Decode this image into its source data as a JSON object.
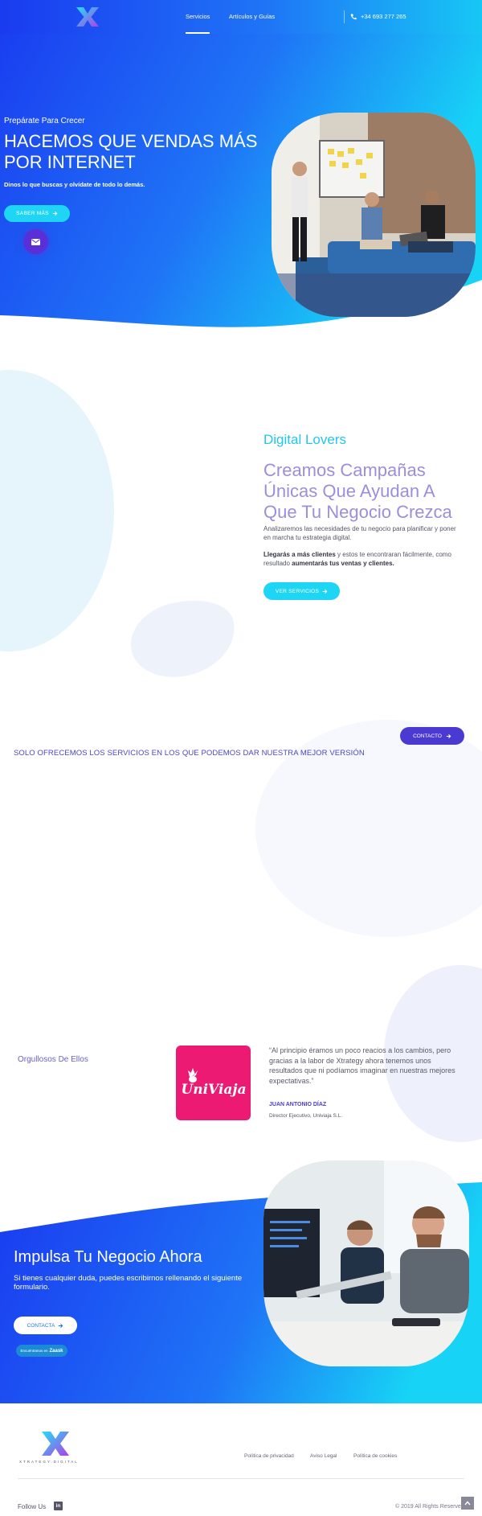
{
  "header": {
    "nav": [
      {
        "label": "Servicios",
        "active": true
      },
      {
        "label": "Artículos y Guías",
        "active": false
      }
    ],
    "phone": "+34 693 277 265",
    "icons": [
      "logo-x",
      "phone-icon"
    ]
  },
  "hero": {
    "kicker": "Prepárate Para Crecer",
    "title": "HACEMOS QUE VENDAS MÁS POR INTERNET",
    "subtitle": "Dinos lo que buscas y olvídate de todo lo demás.",
    "cta": "SABER MÁS",
    "icons": [
      "arrow-right-icon",
      "mail-icon"
    ]
  },
  "lovers": {
    "kicker": "Digital Lovers",
    "title": "Creamos Campañas Únicas Que Ayudan A Que Tu Negocio Crezca",
    "p1": "Analizaremos las necesidades de tu negocio para planificar y poner en marcha tu estrategia digital.",
    "p2_a": "Llegarás a más clientes",
    "p2_b": " y estos te encontraran fácilmente, como resultado ",
    "p2_c": "aumentarás tus ventas y clientes.",
    "cta": "VER SERVICIOS"
  },
  "services": {
    "contact_button": "CONTACTO",
    "heading": "SOLO OFRECEMOS LOS SERVICIOS EN LOS QUE PODEMOS DAR NUESTRA MEJOR VERSIÓN"
  },
  "testimonial": {
    "kicker": "Orgullosos De Ellos",
    "logo_text": "UniViaja",
    "quote": "“Al principio éramos un poco reacios a los cambios, pero gracias a la labor de Xtrategy ahora tenemos unos resultados que ni podíamos imaginar en nuestras mejores expectativas.”",
    "name": "JUAN ANTONIO DÍAZ",
    "role": "Director Ejecutivo, Univiaja S.L."
  },
  "cta": {
    "title": "Impulsa Tu Negocio Ahora",
    "subtitle": "Si tienes cualquier duda, puedes escribirnos rellenando el siguiente formulario.",
    "button": "CONTACTA",
    "zaask_prefix": "Encuéntranos en",
    "zaask_brand": "Zaask"
  },
  "footer": {
    "brand": "XTRATEGY.DIGITAL",
    "links": [
      "Política de privacidad",
      "Aviso Legal",
      "Política de cookies"
    ],
    "follow": "Follow Us",
    "linkedin": "in",
    "copyright": "© 2019 All Rights Reserved"
  },
  "colors": {
    "blue": "#1a3bf0",
    "cyan": "#1ed6f3",
    "purple": "#4b3ad1",
    "lavender": "#9b8fdc",
    "pink": "#ec1a72"
  }
}
